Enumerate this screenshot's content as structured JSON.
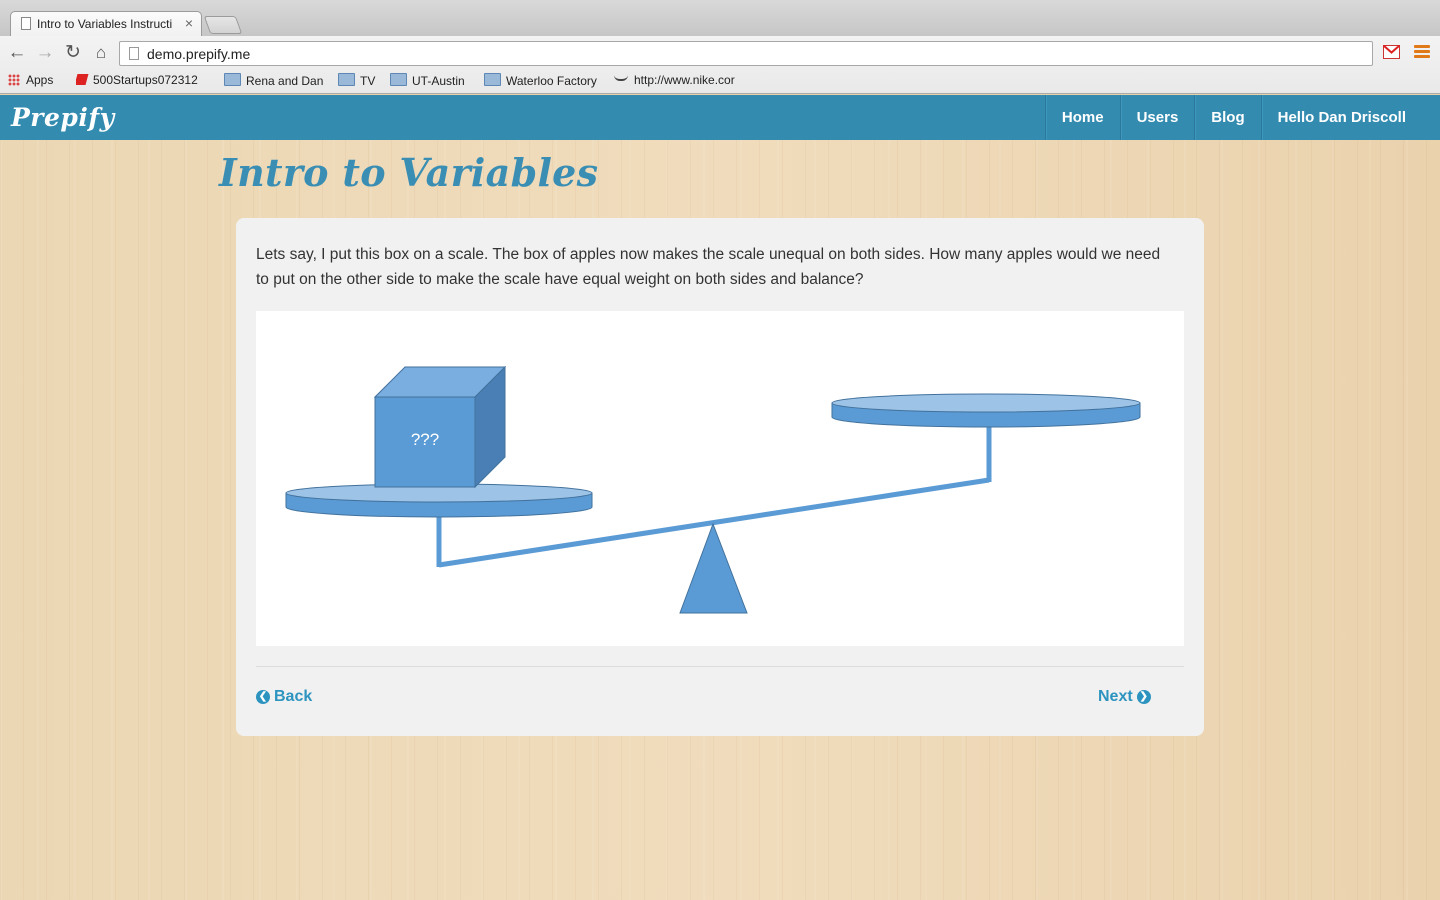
{
  "browser": {
    "tab_title": "Intro to Variables Instructi",
    "tab_close": "×",
    "url": "demo.prepify.me",
    "bookmarks": [
      {
        "label": "Apps",
        "icon": "apps-grid-icon"
      },
      {
        "label": "500Startups072312",
        "icon": "bookmark-red-icon"
      },
      {
        "label": "Rena and Dan",
        "icon": "folder-icon"
      },
      {
        "label": "TV",
        "icon": "folder-icon"
      },
      {
        "label": "UT-Austin",
        "icon": "folder-icon"
      },
      {
        "label": "Waterloo Factory",
        "icon": "folder-icon"
      },
      {
        "label": "http://www.nike.cor",
        "icon": "nike-swoosh-icon"
      }
    ]
  },
  "site": {
    "brand": "Prepify",
    "nav": [
      "Home",
      "Users",
      "Blog",
      "Hello Dan Driscoll"
    ],
    "accent_color": "#338bb0"
  },
  "lesson": {
    "title": "Intro to Variables",
    "prompt": "Lets say, I put this box on a scale. The box of apples now makes the scale unequal on both sides. How many apples would we need to put on the other side to make the scale have equal weight on both sides and balance?",
    "box_label": "???",
    "back_label": "Back",
    "next_label": "Next"
  }
}
